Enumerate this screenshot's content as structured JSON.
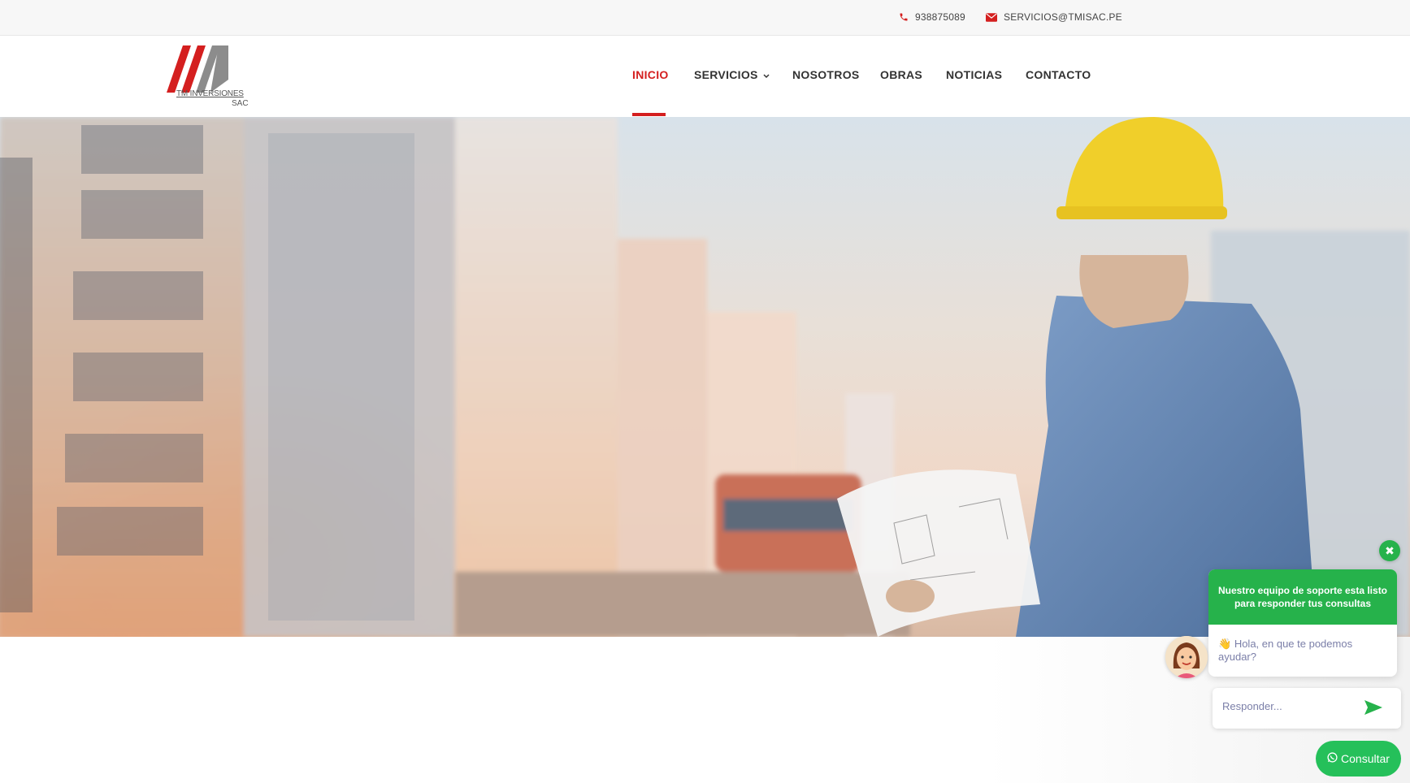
{
  "topbar": {
    "phone": "938875089",
    "phone_icon": "phone-icon",
    "email": "SERVICIOS@TMISAC.PE",
    "email_icon": "envelope-icon"
  },
  "logo": {
    "line1": "TM INVERSIONES",
    "line2": "SAC"
  },
  "nav": {
    "items": [
      {
        "label": "INICIO",
        "active": true
      },
      {
        "label": "SERVICIOS",
        "has_dropdown": true
      },
      {
        "label": "NOSOTROS"
      },
      {
        "label": "OBRAS"
      },
      {
        "label": "NOTICIAS"
      },
      {
        "label": "CONTACTO"
      }
    ],
    "dropdown_icon": "chevron-down-icon"
  },
  "chat": {
    "close_icon": "close-icon",
    "header": "Nuestro equipo de soporte esta listo para responder tus consultas",
    "message_emoji": "👋",
    "message": "Hola, en que te podemos ayudar?",
    "reply_placeholder": "Responder...",
    "send_icon": "send-icon",
    "consult_label": "Consultar",
    "consult_icon": "whatsapp-icon"
  },
  "colors": {
    "accent": "#d41f1f",
    "chat_green": "#26b24b",
    "consult_green": "#25c05a"
  }
}
